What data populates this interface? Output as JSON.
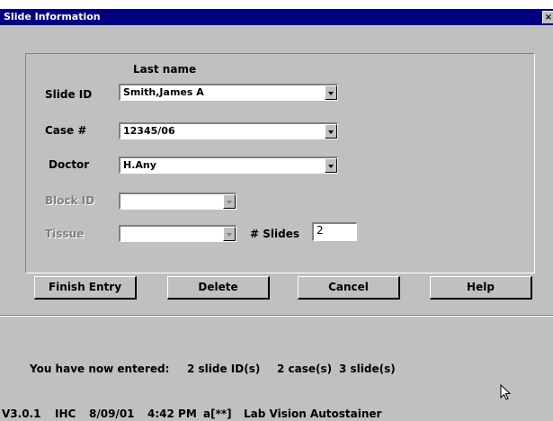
{
  "window": {
    "title": "Slide Information",
    "close_glyph": "×"
  },
  "form": {
    "column_header": "Last name",
    "slide_id": {
      "label": "Slide ID",
      "value": "Smith,James A"
    },
    "case": {
      "label": "Case #",
      "value": "12345/06"
    },
    "doctor": {
      "label": "Doctor",
      "value": "H.Any"
    },
    "block_id": {
      "label": "Block ID",
      "value": ""
    },
    "tissue": {
      "label": "Tissue",
      "value": ""
    },
    "num_slides": {
      "label": "# Slides",
      "value": "2"
    }
  },
  "buttons": {
    "finish": "Finish Entry",
    "delete": "Delete",
    "cancel": "Cancel",
    "help": "Help"
  },
  "summary": {
    "prefix": "You have now entered:",
    "slide_ids": "2 slide ID(s)",
    "cases": "2 case(s)",
    "slides": "3 slide(s)"
  },
  "status": {
    "version": "V3.0.1",
    "mode": "IHC",
    "date": "8/09/01",
    "time": "4:42 PM",
    "user": "a[**]",
    "product": "Lab Vision Autostainer"
  },
  "colors": {
    "titlebar": "#000080",
    "face": "#c0c0c0"
  }
}
